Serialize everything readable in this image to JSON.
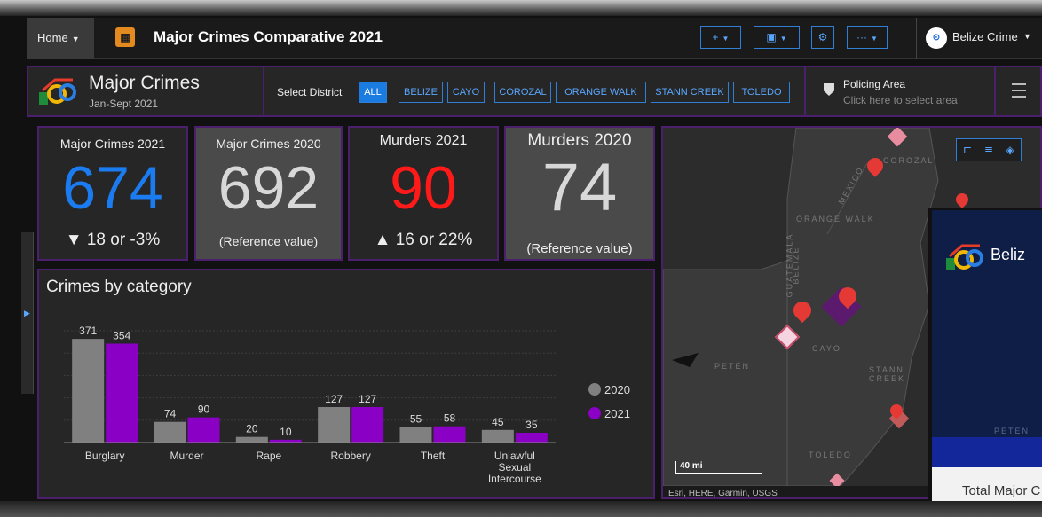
{
  "topbar": {
    "home_label": "Home",
    "app_title": "Major Crimes Comparative 2021",
    "org_name": "Belize Crime"
  },
  "header": {
    "title": "Major Crimes",
    "subtitle": "Jan-Sept 2021",
    "select_district_label": "Select District",
    "districts": [
      "ALL",
      "BELIZE",
      "CAYO",
      "COROZAL",
      "ORANGE WALK",
      "STANN CREEK",
      "TOLEDO"
    ],
    "selected_district": "ALL",
    "policing_title": "Policing Area",
    "policing_subtitle": "Click here to select area"
  },
  "kpis": [
    {
      "title": "Major Crimes 2021",
      "value": "674",
      "footer": "▼ 18 or -3%",
      "color": "#1a7cf0"
    },
    {
      "title": "Major Crimes 2020",
      "value": "692",
      "footer": "(Reference value)",
      "color": "#d8d8d8"
    },
    {
      "title": "Murders 2021",
      "value": "90",
      "footer": "▲ 16 or 22%",
      "color": "#ff1a1a"
    },
    {
      "title": "Murders 2020",
      "value": "74",
      "footer": "(Reference value)",
      "color": "#d8d8d8"
    }
  ],
  "chart_data": {
    "type": "bar",
    "title": "Crimes by category",
    "categories": [
      "Burglary",
      "Murder",
      "Rape",
      "Robbery",
      "Theft",
      "Unlawful Sexual Intercourse"
    ],
    "series": [
      {
        "name": "2020",
        "values": [
          371,
          74,
          20,
          127,
          55,
          45
        ],
        "color": "#808080"
      },
      {
        "name": "2021",
        "values": [
          354,
          90,
          10,
          127,
          58,
          35
        ],
        "color": "#8a00c4"
      }
    ],
    "ylim": [
      0,
      400
    ],
    "grid": true,
    "legend": "right"
  },
  "map": {
    "labels": [
      "COROZAL",
      "MEXICO",
      "ORANGE WALK",
      "GUATEMALA",
      "BELIZE",
      "CAYO",
      "PETÉN",
      "STANN CREEK",
      "TOLEDO"
    ],
    "scale_label": "40 mi",
    "attribution": "Esri, HERE, Garmin, USGS"
  },
  "overlay": {
    "title": "Beliz",
    "map_label": "PETÉN",
    "text": "Total Major C"
  }
}
